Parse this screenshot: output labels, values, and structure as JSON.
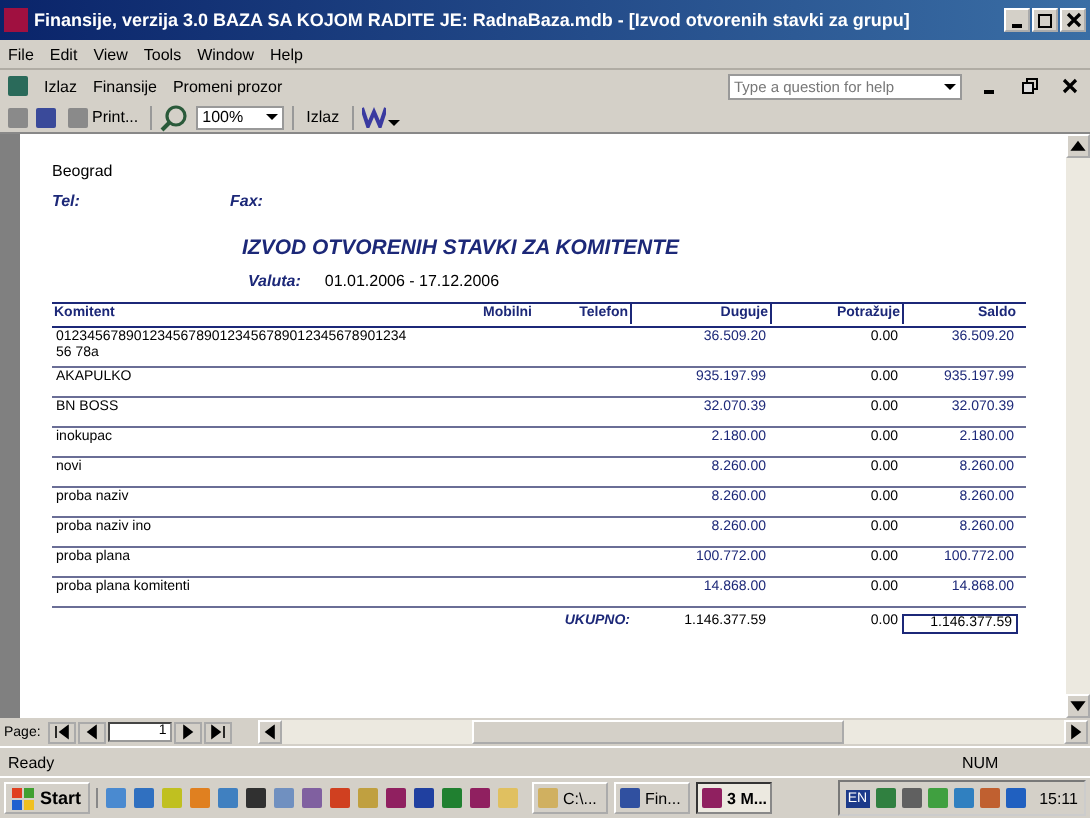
{
  "window": {
    "title": "Finansije, verzija 3.0      BAZA SA KOJOM RADITE JE: RadnaBaza.mdb - [Izvod otvorenih stavki za grupu]"
  },
  "menu": [
    "File",
    "Edit",
    "View",
    "Tools",
    "Window",
    "Help"
  ],
  "toolbar": {
    "items": [
      "Izlaz",
      "Finansije",
      "Promeni prozor"
    ],
    "help_placeholder": "Type a question for help"
  },
  "preview_toolbar": {
    "print": "Print...",
    "zoom": "100%",
    "close": "Izlaz"
  },
  "report": {
    "city": "Beograd",
    "tel_label": "Tel:",
    "fax_label": "Fax:",
    "title": "IZVOD OTVORENIH STAVKI ZA KOMITENTE",
    "currency_label": "Valuta:",
    "period": "01.01.2006 - 17.12.2006",
    "columns": [
      "Komitent",
      "Mobilni",
      "Telefon",
      "Duguje",
      "Potražuje",
      "Saldo"
    ],
    "rows": [
      {
        "name": "01234567890123456789012345678901234567890123456 78a",
        "debit": "36.509.20",
        "credit": "0.00",
        "balance": "36.509.20"
      },
      {
        "name": "AKAPULKO",
        "debit": "935.197.99",
        "credit": "0.00",
        "balance": "935.197.99"
      },
      {
        "name": "BN BOSS",
        "debit": "32.070.39",
        "credit": "0.00",
        "balance": "32.070.39"
      },
      {
        "name": "inokupac",
        "debit": "2.180.00",
        "credit": "0.00",
        "balance": "2.180.00"
      },
      {
        "name": "novi",
        "debit": "8.260.00",
        "credit": "0.00",
        "balance": "8.260.00"
      },
      {
        "name": "proba naziv",
        "debit": "8.260.00",
        "credit": "0.00",
        "balance": "8.260.00"
      },
      {
        "name": "proba naziv ino",
        "debit": "8.260.00",
        "credit": "0.00",
        "balance": "8.260.00"
      },
      {
        "name": "proba plana",
        "debit": "100.772.00",
        "credit": "0.00",
        "balance": "100.772.00"
      },
      {
        "name": "proba plana komitenti",
        "debit": "14.868.00",
        "credit": "0.00",
        "balance": "14.868.00"
      }
    ],
    "total_label": "UKUPNO:",
    "total_debit": "1.146.377.59",
    "total_credit": "0.00",
    "total_balance": "1.146.377.59"
  },
  "pager": {
    "label": "Page:",
    "value": "1"
  },
  "status_bar": {
    "text": "Ready",
    "num": "NUM"
  },
  "taskbar": {
    "start": "Start",
    "buttons": [
      {
        "label": "C:\\...",
        "selected": false
      },
      {
        "label": "Fin...",
        "selected": false
      },
      {
        "label": "3 M...",
        "selected": true
      }
    ],
    "lang": "EN",
    "clock": "15:11"
  }
}
